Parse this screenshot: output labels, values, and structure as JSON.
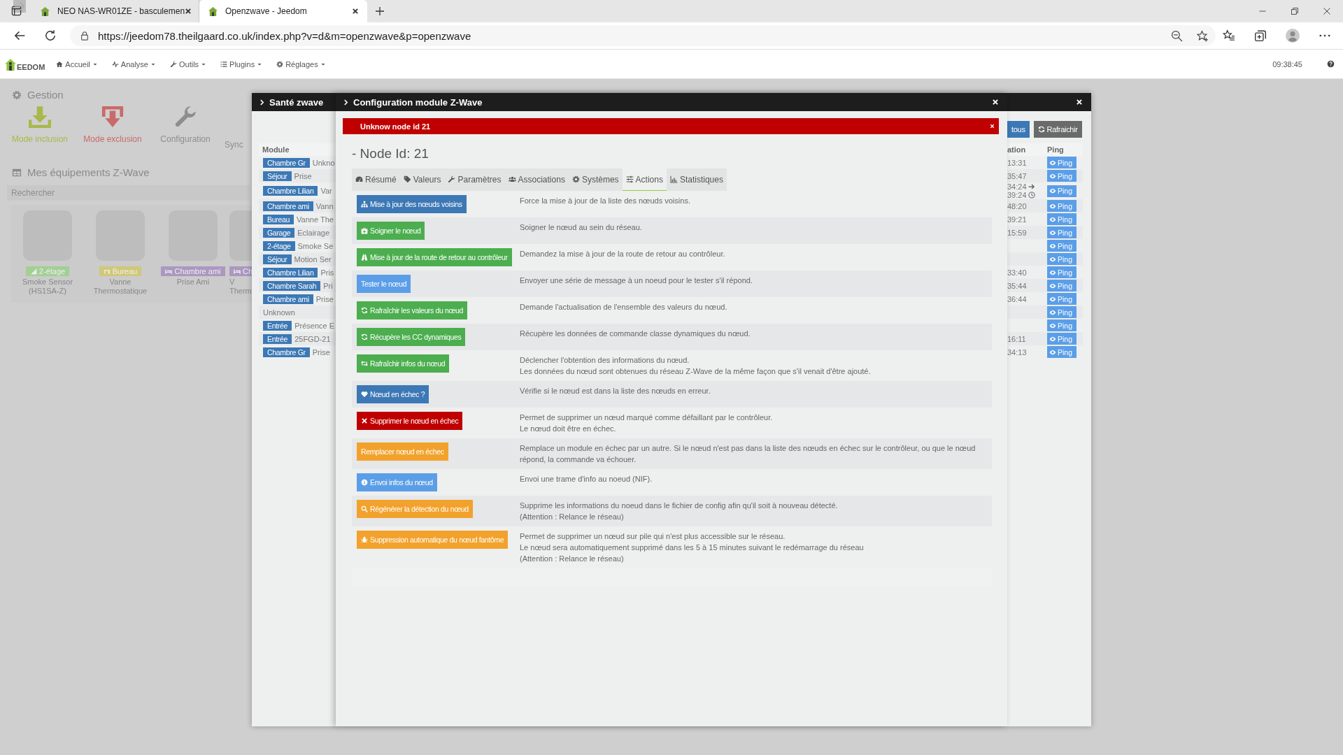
{
  "browser": {
    "tabs": [
      {
        "title": "NEO NAS-WR01ZE - basculemen",
        "selected": false
      },
      {
        "title": "Openzwave - Jeedom",
        "selected": true
      }
    ],
    "url": "https://jeedom78.theilgaard.co.uk/index.php?v=d&m=openzwave&p=openzwave"
  },
  "navbar": {
    "logo": "EEDOM",
    "menus": [
      {
        "label": "Accueil"
      },
      {
        "label": "Analyse"
      },
      {
        "label": "Outils"
      },
      {
        "label": "Plugins"
      },
      {
        "label": "Réglages"
      }
    ],
    "time": "09:38:45"
  },
  "page": {
    "section_title": "Gestion",
    "actions": [
      {
        "label": "Mode inclusion",
        "kind": "inclusion"
      },
      {
        "label": "Mode exclusion",
        "kind": "exclusion"
      },
      {
        "label": "Configuration",
        "kind": "configuration"
      },
      {
        "label": "Sync",
        "kind": "sync"
      }
    ],
    "equipment_title": "Mes équipements Z-Wave",
    "search": {
      "placeholder": "Rechercher"
    },
    "devices": [
      {
        "room": "2-étage",
        "name_lines": [
          "Smoke Sensor",
          "(HS1SA-Z)"
        ],
        "color": "#a3cf94"
      },
      {
        "room": "Bureau",
        "name_lines": [
          "Vanne",
          "Thermostatique"
        ],
        "color": "#cfc878"
      },
      {
        "room": "Chambre ami",
        "name_lines": [
          "Prise Ami"
        ],
        "color": "#ab98c0"
      },
      {
        "room": "Ch",
        "name_lines": [
          "V",
          "Therm"
        ],
        "color": "#ab98c0"
      }
    ]
  },
  "health": {
    "title": "Santé zwave",
    "buttons": [
      {
        "label": "tous",
        "kind": "primary"
      },
      {
        "label": "Rafraichir",
        "kind": "default"
      }
    ],
    "columns": [
      "Module",
      "ation",
      "Ping"
    ],
    "rows": [
      {
        "object": "Chambre Gr",
        "module": "Unkno",
        "time": [
          "13:31"
        ],
        "ping": "Ping"
      },
      {
        "object": "Séjour",
        "module": "Prise",
        "time": [
          "35:47"
        ],
        "ping": "Ping"
      },
      {
        "object": "Chambre Lilian",
        "module": "Var",
        "time": [
          "34:24",
          "39:24"
        ],
        "ping": "Ping"
      },
      {
        "object": "Chambre ami",
        "module": "Vann",
        "time": [
          "48:20"
        ],
        "ping": "Ping"
      },
      {
        "object": "Bureau",
        "module": "Vanne The",
        "time": [
          "39:21"
        ],
        "ping": "Ping"
      },
      {
        "object": "Garage",
        "module": "Eclairage",
        "time": [
          "15:59"
        ],
        "ping": "Ping"
      },
      {
        "object": "2-étage",
        "module": "Smoke Se",
        "ping": "Ping"
      },
      {
        "object": "Séjour",
        "module": "Motion Ser",
        "ping": "Ping"
      },
      {
        "object": "Chambre Lilian",
        "module": "Pris",
        "time": [
          "33:40"
        ],
        "ping": "Ping"
      },
      {
        "object": "Chambre Sarah",
        "module": "Pri",
        "time": [
          "35:44"
        ],
        "ping": "Ping"
      },
      {
        "object": "Chambre ami",
        "module": "Prise",
        "time": [
          "36:44"
        ],
        "ping": "Ping"
      },
      {
        "module": "Unknown",
        "ping": "Ping"
      },
      {
        "object": "Entrée",
        "module": "Présence E",
        "ping": "Ping"
      },
      {
        "object": "Entrée",
        "module": "25FGD-21",
        "time": [
          "16:11"
        ],
        "ping": "Ping"
      },
      {
        "object": "Chambre Gr",
        "module": "Prise",
        "time": [
          "34:13"
        ],
        "ping": "Ping"
      }
    ]
  },
  "config": {
    "title": "Configuration module Z-Wave",
    "alert": "Unknow node id 21",
    "node_title": "- Node Id: 21",
    "tabs": [
      {
        "label": "Résumé",
        "selected": false
      },
      {
        "label": "Valeurs",
        "selected": false
      },
      {
        "label": "Paramètres",
        "selected": false
      },
      {
        "label": "Associations",
        "selected": false
      },
      {
        "label": "Systèmes",
        "selected": false
      },
      {
        "label": "Actions",
        "selected": true
      },
      {
        "label": "Statistiques",
        "selected": false
      }
    ],
    "actions": [
      {
        "label": "Mise à jour des nœuds voisins",
        "kind": "primary",
        "description": [
          "Force la mise à jour de la liste des nœuds voisins."
        ]
      },
      {
        "label": "Soigner le nœud",
        "kind": "success",
        "description": [
          "Soigner le nœud au sein du réseau."
        ]
      },
      {
        "label": "Mise à jour de la route de retour au contrôleur",
        "kind": "success",
        "description": [
          "Demandez la mise à jour de la route de retour au contrôleur."
        ]
      },
      {
        "label": "Tester le nœud",
        "kind": "info",
        "description": [
          "Envoyer une série de message à un noeud pour le tester s'il répond."
        ]
      },
      {
        "label": "Rafraîchir les valeurs du nœud",
        "kind": "success",
        "description": [
          "Demande l'actualisation de l'ensemble des valeurs du nœud."
        ]
      },
      {
        "label": "Récupère les CC dynamiques",
        "kind": "success",
        "description": [
          "Récupère les données de commande classe dynamiques du nœud."
        ]
      },
      {
        "label": "Rafraîchir infos du nœud",
        "kind": "success",
        "description": [
          "Déclencher l'obtention des informations du nœud.",
          "Les données du nœud sont obtenues du réseau Z-Wave de la même façon que s'il venait d'être ajouté."
        ]
      },
      {
        "label": "Nœud en échec ?",
        "kind": "primary",
        "description": [
          "Vérifie si le nœud est dans la liste des nœuds en erreur."
        ]
      },
      {
        "label": "Supprimer le nœud en échec",
        "kind": "danger",
        "description": [
          "Permet de supprimer un nœud marqué comme défaillant par le contrôleur.",
          "Le nœud doit être en échec."
        ]
      },
      {
        "label": "Remplacer nœud en échec",
        "kind": "warning",
        "description": [
          "Remplace un module en échec par un autre. Si le nœud n'est pas dans la liste des nœuds en échec sur le contrôleur, ou que le nœud répond, la commande va échouer."
        ]
      },
      {
        "label": "Envoi infos du nœud",
        "kind": "info",
        "description": [
          "Envoi une trame d'info au noeud (NIF)."
        ]
      },
      {
        "label": "Régénérer la détection du nœud",
        "kind": "warning",
        "description": [
          "Supprime les informations du noeud dans le fichier de config afin qu'il soit à nouveau détecté.",
          "(Attention : Relance le réseau)"
        ]
      },
      {
        "label": "Suppression automatique du nœud fantôme",
        "kind": "warning",
        "description": [
          "Permet de supprimer un nœud sur pile qui n'est plus accessible sur le réseau.",
          "Le nœud sera automatiquement supprimé dans les 5 à 15 minutes suivant le redémarrage du réseau",
          "(Attention : Relance le réseau)"
        ]
      }
    ]
  }
}
